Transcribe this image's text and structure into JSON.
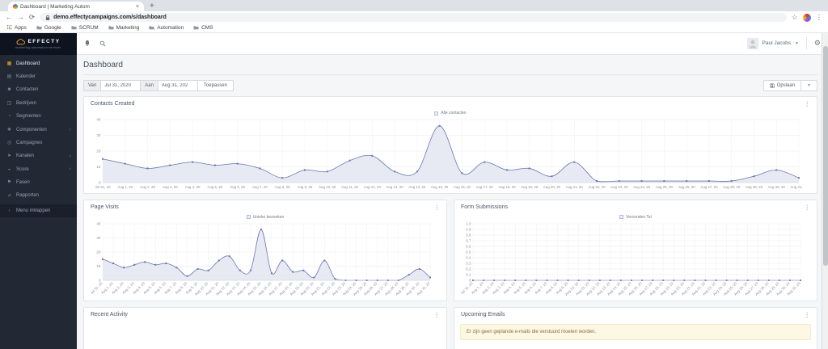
{
  "browser": {
    "tab_title": "Dashboard | Marketing Autom",
    "close_tab_glyph": "×",
    "new_tab_glyph": "+",
    "url": "demo.effectycampaigns.com/s/dashboard",
    "bookmarks": [
      "Apps",
      "Google",
      "SCRUM",
      "Marketing",
      "Automation",
      "CMS"
    ]
  },
  "sidebar": {
    "logo_title": "EFFECTY",
    "logo_tagline": "marketing automation services",
    "items": [
      {
        "label": "Dashboard",
        "icon": "dashboard-icon",
        "active": true
      },
      {
        "label": "Kalender",
        "icon": "calendar-icon"
      },
      {
        "label": "Contacten",
        "icon": "contacts-icon"
      },
      {
        "label": "Bedrijven",
        "icon": "companies-icon"
      },
      {
        "label": "Segmenten",
        "icon": "segments-icon"
      },
      {
        "label": "Componenten",
        "icon": "components-icon",
        "submenu": true
      },
      {
        "label": "Campagnes",
        "icon": "campaigns-icon"
      },
      {
        "label": "Kanalen",
        "icon": "channels-icon",
        "submenu": true
      },
      {
        "label": "Score",
        "icon": "points-icon",
        "submenu": true
      },
      {
        "label": "Fasen",
        "icon": "stages-icon"
      },
      {
        "label": "Rapporten",
        "icon": "reports-icon"
      },
      {
        "label": "Menu inklappen",
        "icon": "collapse-icon",
        "collapse": true
      }
    ]
  },
  "header": {
    "user_name": "Paul Jacobs"
  },
  "page": {
    "title": "Dashboard",
    "filters": {
      "from_label": "Van",
      "from_value": "Jul 31, 2020",
      "to_label": "Aan",
      "to_value": "Aug 31, 202",
      "apply_label": "Toepassen",
      "save_label": "Opslaan"
    }
  },
  "panels": {
    "contacts_created": {
      "title": "Contacts Created",
      "legend": "Alle contacten"
    },
    "page_visits": {
      "title": "Page Visits",
      "legend": "Unieke bezoeken"
    },
    "form_submissions": {
      "title": "Form Submissions",
      "legend": "Verzonden Tel"
    },
    "recent_activity": {
      "title": "Recent Activity"
    },
    "upcoming_emails": {
      "title": "Upcoming Emails",
      "empty_message": "Er zijn geen geplande e-mails die verstuurd moeten worden."
    }
  },
  "colors": {
    "line": "#6b77af",
    "fill": "#e7e9f3",
    "sidebar_bg": "#222834",
    "accent_orange": "#f5a623",
    "alert_bg": "#fcf8e3"
  },
  "chart_data": [
    {
      "id": "contacts_created",
      "type": "area",
      "title": "Contacts Created",
      "legend": "Alle contacten",
      "x": [
        "Jul 31, 20",
        "Aug 1, 20",
        "Aug 2, 20",
        "Aug 3, 20",
        "Aug 4, 20",
        "Aug 5, 20",
        "Aug 6, 20",
        "Aug 7, 20",
        "Aug 8, 20",
        "Aug 9, 20",
        "Aug 10, 20",
        "Aug 11, 20",
        "Aug 12, 20",
        "Aug 13, 20",
        "Aug 14, 20",
        "Aug 15, 20",
        "Aug 16, 20",
        "Aug 17, 20",
        "Aug 18, 20",
        "Aug 19, 20",
        "Aug 20, 20",
        "Aug 21, 20",
        "Aug 22, 20",
        "Aug 23, 20",
        "Aug 24, 20",
        "Aug 25, 20",
        "Aug 26, 20",
        "Aug 27, 20",
        "Aug 28, 20",
        "Aug 29, 20",
        "Aug 30, 20",
        "Aug 31, 20"
      ],
      "values": [
        15,
        12,
        9,
        11,
        13,
        11,
        12,
        9,
        3,
        8,
        7,
        14,
        17,
        7,
        7,
        36,
        6,
        13,
        8,
        9,
        4,
        13,
        1,
        1,
        1,
        1,
        1,
        1,
        1,
        4,
        8,
        3
      ],
      "ylim": [
        0,
        40
      ],
      "yticks": [
        0,
        10,
        20,
        30,
        40
      ],
      "label_rotation": 0,
      "grid": true,
      "legend_position": "top"
    },
    {
      "id": "page_visits",
      "type": "area",
      "title": "Page Visits",
      "legend": "Unieke bezoeken",
      "x": [
        "Jul 31, 20",
        "Aug 1, 20",
        "Aug 2, 20",
        "Aug 3, 20",
        "Aug 4, 20",
        "Aug 5, 20",
        "Aug 6, 20",
        "Aug 7, 20",
        "Aug 8, 20",
        "Aug 9, 20",
        "Aug 10, 20",
        "Aug 11, 20",
        "Aug 12, 20",
        "Aug 13, 20",
        "Aug 14, 20",
        "Aug 15, 20",
        "Aug 16, 20",
        "Aug 17, 20",
        "Aug 18, 20",
        "Aug 19, 20",
        "Aug 20, 20",
        "Aug 21, 20",
        "Aug 22, 20",
        "Aug 23, 20",
        "Aug 24, 20",
        "Aug 25, 20",
        "Aug 26, 20",
        "Aug 27, 20",
        "Aug 28, 20",
        "Aug 29, 20",
        "Aug 30, 20",
        "Aug 31, 20"
      ],
      "values": [
        15,
        12,
        9,
        11,
        13,
        11,
        12,
        9,
        3,
        8,
        7,
        14,
        17,
        7,
        7,
        36,
        5,
        14,
        6,
        7,
        2,
        14,
        1,
        0,
        0,
        0,
        0,
        0,
        0,
        4,
        8,
        2
      ],
      "ylim": [
        0,
        40
      ],
      "yticks": [
        0,
        10,
        20,
        30,
        40
      ],
      "label_rotation": 45,
      "grid": true,
      "legend_position": "top"
    },
    {
      "id": "form_submissions",
      "type": "area",
      "title": "Form Submissions",
      "legend": "Verzonden Tel",
      "x": [
        "Jul 31, 20",
        "Aug 1, 20",
        "Aug 2, 20",
        "Aug 3, 20",
        "Aug 4, 20",
        "Aug 5, 20",
        "Aug 6, 20",
        "Aug 7, 20",
        "Aug 8, 20",
        "Aug 9, 20",
        "Aug 10, 20",
        "Aug 11, 20",
        "Aug 12, 20",
        "Aug 13, 20",
        "Aug 14, 20",
        "Aug 15, 20",
        "Aug 16, 20",
        "Aug 17, 20",
        "Aug 18, 20",
        "Aug 19, 20",
        "Aug 20, 20",
        "Aug 21, 20",
        "Aug 22, 20",
        "Aug 23, 20",
        "Aug 24, 20",
        "Aug 25, 20",
        "Aug 26, 20",
        "Aug 27, 20",
        "Aug 28, 20",
        "Aug 29, 20",
        "Aug 30, 20",
        "Aug 31, 20"
      ],
      "values": [
        0,
        0,
        0,
        0,
        0,
        0,
        0,
        0,
        0,
        0,
        0,
        0,
        0,
        0,
        0,
        0,
        0,
        0,
        0,
        0,
        0,
        0,
        0,
        0,
        0,
        0,
        0,
        0,
        0,
        0,
        0,
        0
      ],
      "ylim": [
        0,
        1
      ],
      "yticks": [
        0,
        0.1,
        0.2,
        0.3,
        0.4,
        0.5,
        0.6,
        0.7,
        0.8,
        0.9,
        1.0
      ],
      "label_rotation": 45,
      "grid": true,
      "legend_position": "top"
    }
  ]
}
